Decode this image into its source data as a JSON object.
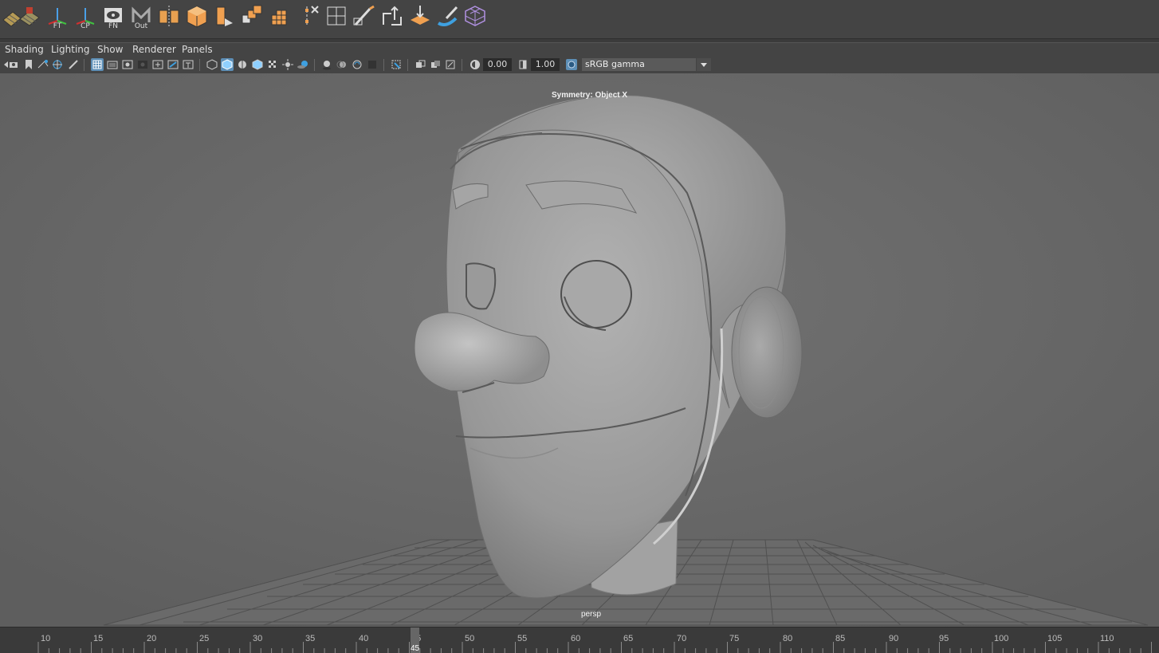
{
  "shelf": {
    "tools": [
      {
        "name": "uv-grid-icon",
        "caption": ""
      },
      {
        "name": "uv-layout-icon",
        "caption": ""
      },
      {
        "name": "freeze-transform-icon",
        "caption": "FT"
      },
      {
        "name": "center-pivot-icon",
        "caption": "CP"
      },
      {
        "name": "freeze-normals-icon",
        "caption": "FN"
      },
      {
        "name": "outliner-icon",
        "caption": "Out"
      }
    ]
  },
  "menu": [
    "Shading",
    "Lighting",
    "Show",
    "Renderer",
    "Panels"
  ],
  "panel_toolbar": {
    "exposure_value": "0.00",
    "gamma_value": "1.00",
    "color_space": "sRGB gamma"
  },
  "viewport": {
    "symmetry_label": "Symmetry: Object X",
    "camera_label": "persp"
  },
  "timeline": {
    "ticks": [
      "10",
      "15",
      "20",
      "25",
      "30",
      "35",
      "40",
      "45",
      "50",
      "55",
      "60",
      "65",
      "70",
      "75",
      "80",
      "85",
      "90",
      "95",
      "100",
      "105",
      "110"
    ],
    "current_frame": "45"
  }
}
